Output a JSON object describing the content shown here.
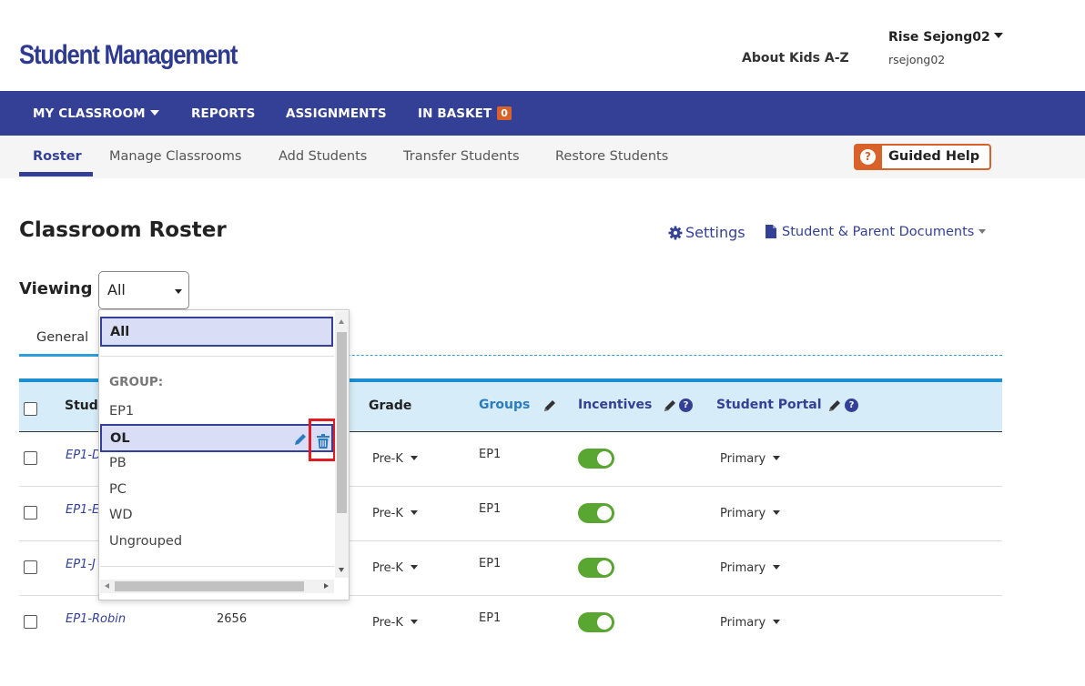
{
  "header": {
    "app_title": "Student Management",
    "about_link": "About Kids A-Z",
    "user_name": "Rise Sejong02",
    "user_login": "rsejong02"
  },
  "main_nav": {
    "items": [
      {
        "label": "MY CLASSROOM"
      },
      {
        "label": "REPORTS"
      },
      {
        "label": "ASSIGNMENTS"
      },
      {
        "label": "IN BASKET",
        "badge": "0"
      }
    ]
  },
  "sub_nav": {
    "items": [
      {
        "label": "Roster",
        "active": true
      },
      {
        "label": "Manage Classrooms"
      },
      {
        "label": "Add Students"
      },
      {
        "label": "Transfer Students"
      },
      {
        "label": "Restore Students"
      }
    ],
    "guided_help": "Guided Help",
    "guided_help_icon": "?"
  },
  "page": {
    "title": "Classroom Roster",
    "settings_link": "Settings",
    "documents_link": "Student & Parent Documents",
    "viewing_label": "Viewing",
    "viewing_value": "All"
  },
  "tabs": {
    "general": "General"
  },
  "dropdown": {
    "selected": "All",
    "group_header": "GROUP:",
    "options": [
      "EP1",
      "OL",
      "PB",
      "PC",
      "WD",
      "Ungrouped"
    ],
    "highlighted": "OL"
  },
  "table": {
    "headers": {
      "student": "Stude",
      "grade": "Grade",
      "groups": "Groups",
      "incentives": "Incentives",
      "student_portal": "Student Portal"
    },
    "rows": [
      {
        "name": "EP1-D",
        "password": "",
        "grade": "Pre-K",
        "groups": "EP1",
        "incentives_on": true,
        "portal": "Primary"
      },
      {
        "name": "EP1-E",
        "password": "",
        "grade": "Pre-K",
        "groups": "EP1",
        "incentives_on": true,
        "portal": "Primary"
      },
      {
        "name": "EP1-J",
        "password": "",
        "grade": "Pre-K",
        "groups": "EP1",
        "incentives_on": true,
        "portal": "Primary"
      },
      {
        "name": "EP1-Robin",
        "password": "2656",
        "grade": "Pre-K",
        "groups": "EP1",
        "incentives_on": true,
        "portal": "Primary"
      }
    ]
  },
  "colors": {
    "brand_blue": "#343f96",
    "accent_orange": "#d9622b",
    "toggle_green": "#5aa632",
    "highlight_red": "#e01b24"
  },
  "icons": [
    "caret-down-icon",
    "gear-icon",
    "document-icon",
    "question-icon",
    "pencil-icon",
    "trash-icon"
  ]
}
